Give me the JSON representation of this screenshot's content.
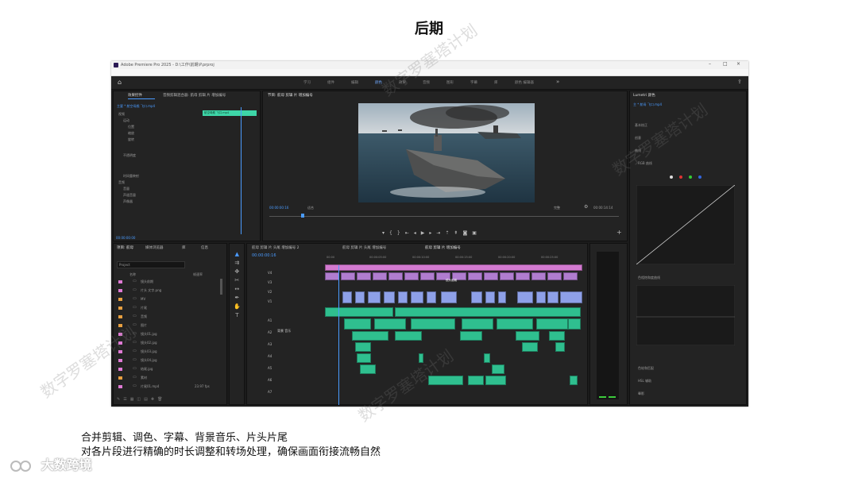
{
  "slide": {
    "title": "后期",
    "caption_line1": "合并剪辑、调色、字幕、背景音乐、片头片尾",
    "caption_line2": "对各片段进行精确的时长调整和转场处理，确保画面衔接流畅自然",
    "logo_text": "大数跨境",
    "watermark": "数字罗塞塔计划"
  },
  "app": {
    "window_title": "Adobe Premiere Pro 2025 - D:\\工作\\前期\\P.prproj",
    "menus": [
      "文件(F)",
      "编辑(E)",
      "剪辑(C)",
      "序列(S)",
      "标记(M)",
      "图形(G)",
      "视图(V)",
      "窗口(W)",
      "帮助(H)"
    ],
    "workspaces": [
      "学习",
      "组件",
      "编辑",
      "颜色",
      "效果",
      "音频",
      "图形",
      "字幕",
      "库",
      "颜色 编辑器"
    ],
    "active_workspace": "颜色"
  },
  "effect_controls": {
    "tabs": [
      "效果控件",
      "音频剪辑混合器: 航母 剪辑 片 增加编号"
    ],
    "source_label": "主要 * 航空母舰 飞口.mp4",
    "clip_label": "航空母舰 飞口.mp4",
    "sections": [
      "视频",
      "运动",
      "位置",
      "缩放",
      "旋转",
      "不透明度",
      "时间重映射",
      "音频",
      "音量",
      "声道音量",
      "声像器"
    ],
    "timecode": "00:00:00:00"
  },
  "program_monitor": {
    "tab": "节目: 航母 剪辑 片 增加编号",
    "timecode": "00:00:00:16",
    "fit_label": "适合",
    "quality": "完整",
    "duration": "00:00:14:14"
  },
  "project_panel": {
    "tabs": [
      "项目: 航母",
      "媒体浏览器",
      "库",
      "信息"
    ],
    "search_placeholder": "Project",
    "columns": [
      "名称",
      "帧速率"
    ],
    "items": [
      {
        "name": "镜头前期",
        "color": "#e07ad5"
      },
      {
        "name": "片头 文字.png",
        "color": "#e07ad5"
      },
      {
        "name": "MV",
        "color": "#e8a040"
      },
      {
        "name": "片尾",
        "color": "#e8a040"
      },
      {
        "name": "音频",
        "color": "#e8a040"
      },
      {
        "name": "图片",
        "color": "#e8a040"
      },
      {
        "name": "镜头01.jpg",
        "color": "#e07ad5"
      },
      {
        "name": "镜头02.jpg",
        "color": "#e07ad5"
      },
      {
        "name": "镜头03.jpg",
        "color": "#e07ad5"
      },
      {
        "name": "镜头04.jpg",
        "color": "#e07ad5"
      },
      {
        "name": "结尾.jpg",
        "color": "#e07ad5"
      },
      {
        "name": "素材",
        "color": "#e8a040"
      },
      {
        "name": "片尾01.mp4",
        "color": "#e07ad5",
        "fps": "23.97 fps"
      }
    ]
  },
  "timeline": {
    "tabs": [
      "航母 剪辑 片 头尾 增加编号 2",
      "航母 剪辑 片 头尾 增加编号",
      "航母 剪辑 片 增加编号"
    ],
    "timecode": "00:00:00:16",
    "ruler": [
      "00:00",
      "00:00:05:00",
      "00:00:10:00",
      "00:00:15:00",
      "00:00:20:00",
      "00:00:25:00"
    ],
    "title_clip": "镜头前期",
    "audio_label": "背景 音乐",
    "video_tracks": [
      "V4",
      "V3",
      "V2",
      "V1"
    ],
    "audio_tracks": [
      "A1",
      "A2",
      "A3",
      "A4",
      "A5",
      "A6",
      "A7"
    ]
  },
  "lumetri": {
    "title": "Lumetri 颜色",
    "clip_label": "主 * 航母 飞口.mp4",
    "sections": [
      "基本校正",
      "创意",
      "曲线",
      "RGB 曲线",
      "色相饱和度曲线",
      "色轮和匹配",
      "HSL 辅助",
      "晕影"
    ]
  },
  "colors": {
    "accent": "#4a9bff",
    "video_clip": "#8ea0e8",
    "audio_clip": "#2fbf8f",
    "title_clip": "#d37ad0",
    "selected": "#3ed6a8"
  }
}
